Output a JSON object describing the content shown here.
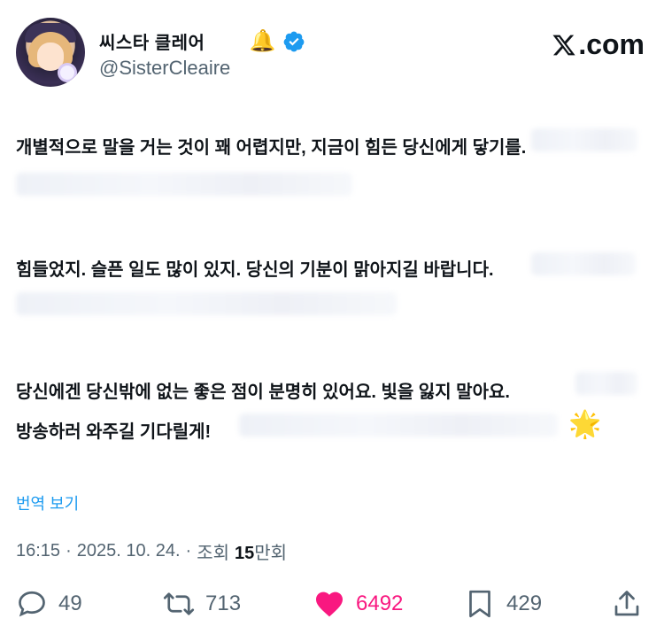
{
  "author": {
    "display_name": "씨스타 클레어",
    "name_emoji": "🔔",
    "handle": "@SisterCleaire"
  },
  "brand": {
    "label": ".com"
  },
  "tweet": {
    "lines": [
      "개별적으로 말을 거는 것이 꽤 어렵지만, 지금이 힘든 당신에게 닿기를.",
      "힘들었지. 슬픈 일도 많이 있지. 당신의 기분이 맑아지길 바랍니다.",
      "당신에겐 당신밖에 없는 좋은 점이 분명히 있어요. 빛을 잃지 말아요.",
      "방송하러 와주길 기다릴게!"
    ],
    "emoji": "🌟"
  },
  "translate_label": "번역 보기",
  "meta": {
    "time": "16:15",
    "sep1": "·",
    "date": "2025. 10. 24.",
    "sep2": "·",
    "views_label": "조회",
    "views_num": "15",
    "views_unit": "만회"
  },
  "actions": {
    "reply_count": "49",
    "retweet_count": "713",
    "like_count": "6492",
    "bookmark_count": "429"
  },
  "colors": {
    "link": "#1d9bf0",
    "like": "#f91880",
    "muted": "#536471",
    "verified": "#1d9bf0"
  }
}
